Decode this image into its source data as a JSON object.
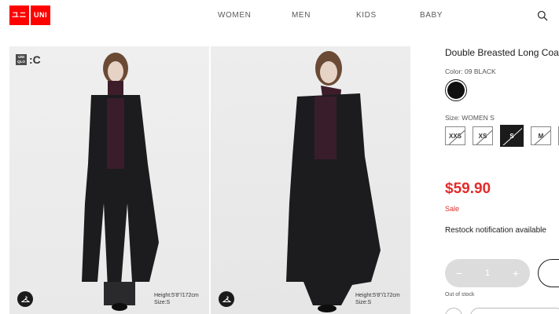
{
  "header": {
    "logo_top_left": "ユニ",
    "logo_top_right": "UNI",
    "logo_bottom_left": "クロ",
    "logo_bottom_right": "QLO",
    "nav": [
      "WOMEN",
      "MEN",
      "KIDS",
      "BABY"
    ],
    "search_icon": "search-icon"
  },
  "gallery": {
    "brand_badge_text": "UNI QLO",
    "brand_badge_letter": ":C",
    "photos": [
      {
        "model_info_height": "Height:5'8\"/172cm",
        "model_info_size": "Size:S"
      },
      {
        "model_info_height": "Height:5'8\"/172cm",
        "model_info_size": "Size:S"
      }
    ],
    "hanger_icon": "hanger-icon"
  },
  "product": {
    "title": "Double Breasted Long Coat",
    "color_label": "Color: 09 BLACK",
    "size_label": "Size: WOMEN S",
    "sizes": [
      "XXS",
      "XS",
      "S",
      "M",
      "L"
    ],
    "selected_size": "S",
    "price": "$59.90",
    "sale_label": "Sale",
    "restock": "Restock notification available",
    "qty_minus": "−",
    "qty_value": "1",
    "qty_plus": "+",
    "out_of_stock": "Out of stock"
  },
  "colors": {
    "brand_red": "#ff0000",
    "price_red": "#e32b2b",
    "swatch_black": "#111111"
  }
}
